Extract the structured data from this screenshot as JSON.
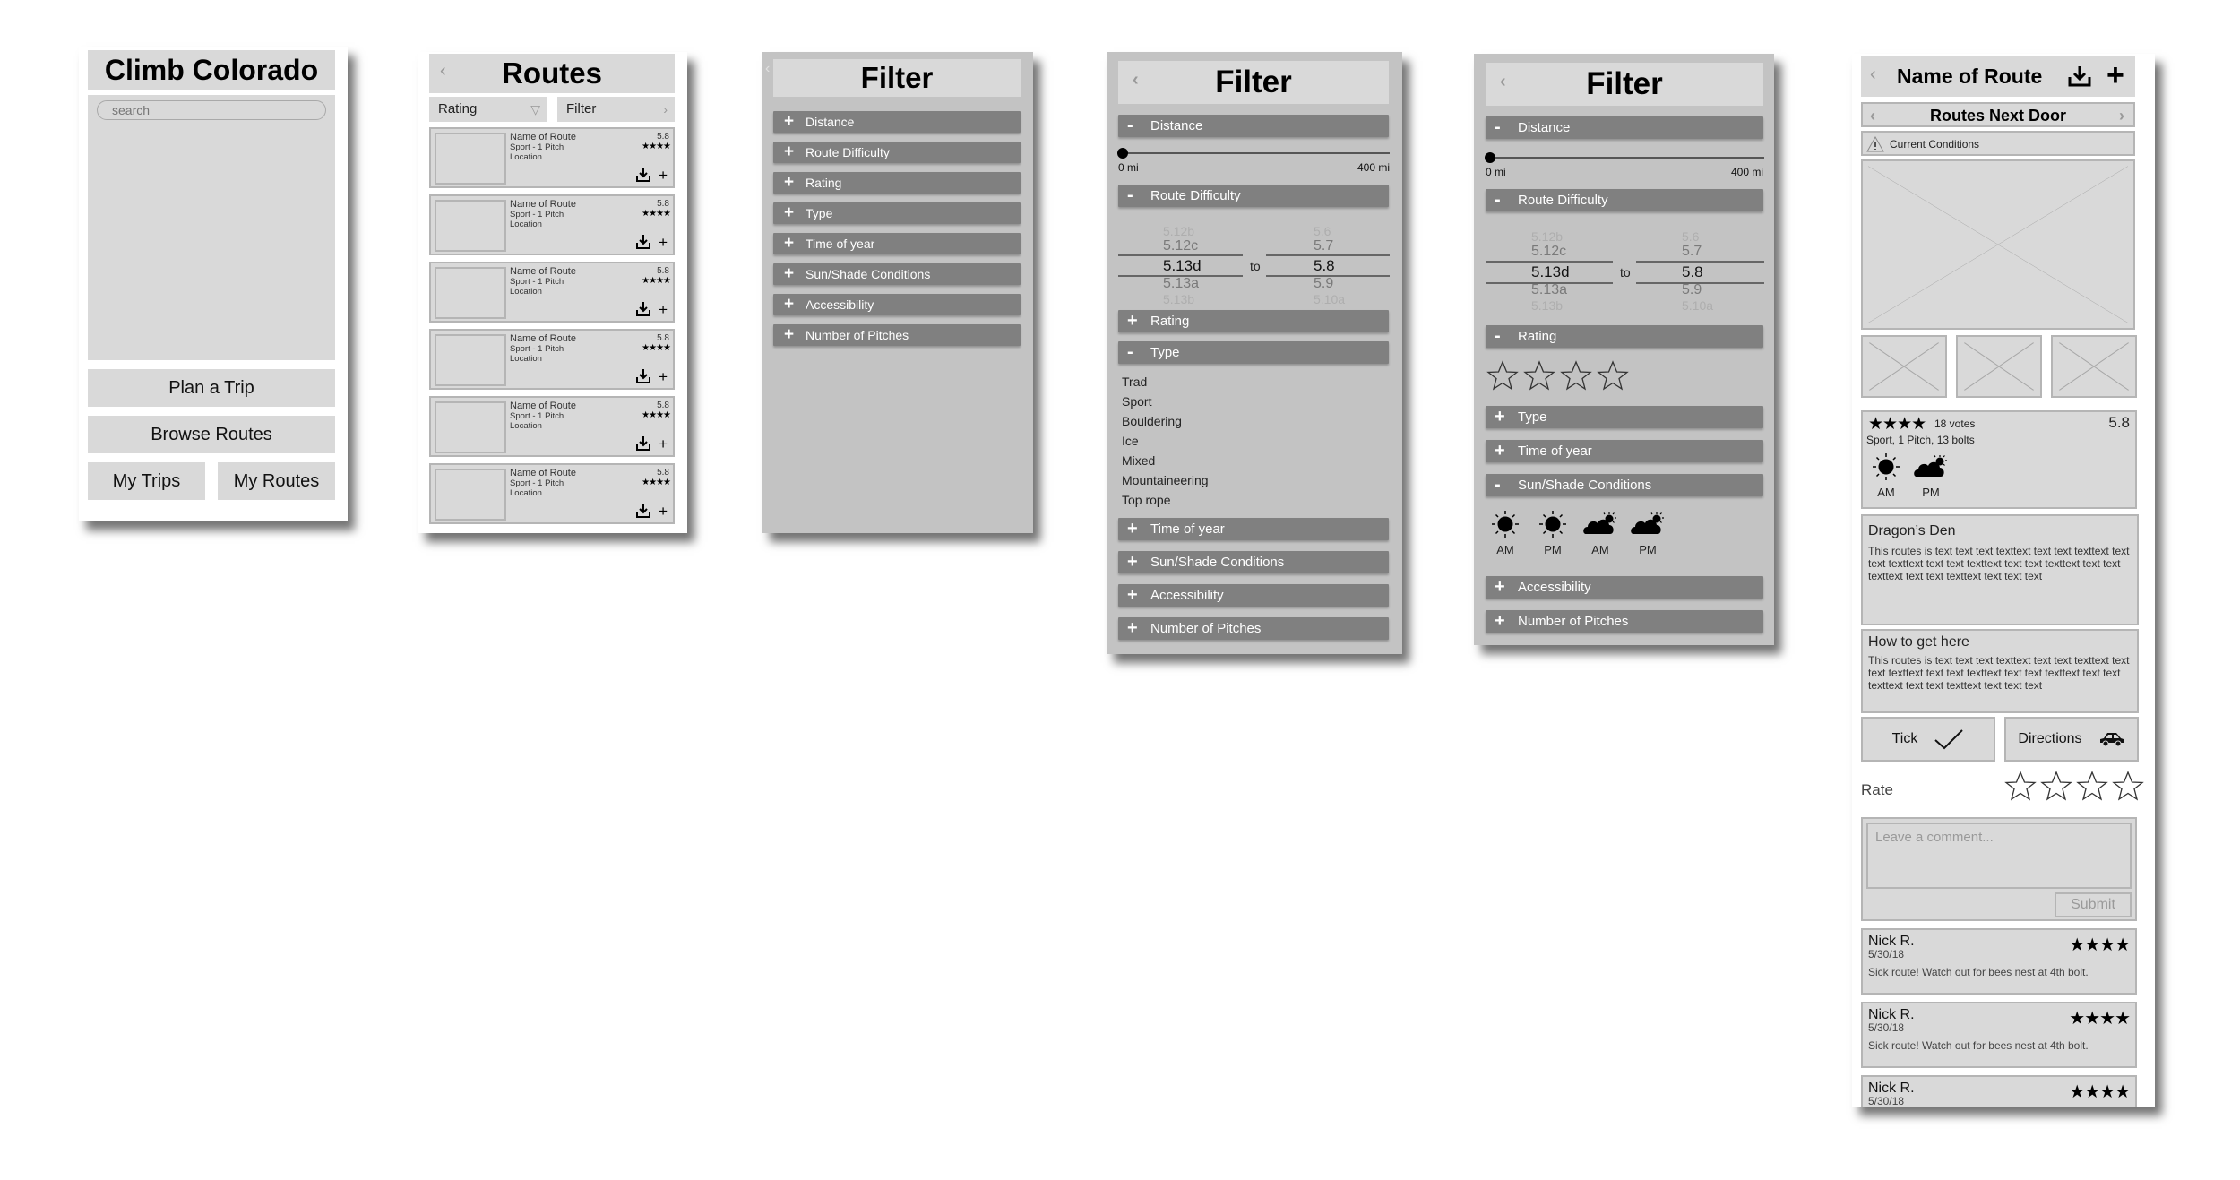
{
  "home": {
    "title": "Climb Colorado",
    "search_placeholder": "search",
    "buttons": {
      "plan_trip": "Plan a Trip",
      "browse_routes": "Browse Routes",
      "my_trips": "My Trips",
      "my_routes": "My Routes"
    }
  },
  "routes": {
    "title": "Routes",
    "back_icon": "‹",
    "sort_label": "Rating",
    "sort_icon": "▽",
    "filter_label": "Filter",
    "filter_icon": "›",
    "items": [
      {
        "name": "Name of Route",
        "subtitle": "Sport - 1 Pitch",
        "location": "Location",
        "grade": "5.8",
        "stars": "★★★★"
      },
      {
        "name": "Name of Route",
        "subtitle": "Sport - 1 Pitch",
        "location": "Location",
        "grade": "5.8",
        "stars": "★★★★"
      },
      {
        "name": "Name of Route",
        "subtitle": "Sport - 1 Pitch",
        "location": "Location",
        "grade": "5.8",
        "stars": "★★★★"
      },
      {
        "name": "Name of Route",
        "subtitle": "Sport - 1 Pitch",
        "location": "Location",
        "grade": "5.8",
        "stars": "★★★★"
      },
      {
        "name": "Name of Route",
        "subtitle": "Sport - 1 Pitch",
        "location": "Location",
        "grade": "5.8",
        "stars": "★★★★"
      },
      {
        "name": "Name of Route",
        "subtitle": "Sport - 1 Pitch",
        "location": "Location",
        "grade": "5.8",
        "stars": "★★★★"
      }
    ],
    "add_icon": "+"
  },
  "filter_collapsed": {
    "title": "Filter",
    "back_icon": "‹",
    "sections": [
      {
        "sign": "+",
        "label": "Distance"
      },
      {
        "sign": "+",
        "label": "Route Difficulty"
      },
      {
        "sign": "+",
        "label": "Rating"
      },
      {
        "sign": "+",
        "label": "Type"
      },
      {
        "sign": "+",
        "label": "Time of year"
      },
      {
        "sign": "+",
        "label": "Sun/Shade Conditions"
      },
      {
        "sign": "+",
        "label": "Accessibility"
      },
      {
        "sign": "+",
        "label": "Number of Pitches"
      }
    ]
  },
  "filter_type": {
    "title": "Filter",
    "back_icon": "‹",
    "distance": {
      "sign": "-",
      "label": "Distance",
      "min_label": "0 mi",
      "max_label": "400 mi",
      "value_fraction": 0.0
    },
    "difficulty": {
      "sign": "-",
      "label": "Route Difficulty",
      "to_label": "to",
      "from": {
        "above2": "5.12b",
        "above1": "5.12c",
        "selected": "5.13d",
        "below1": "5.13a",
        "below2": "5.13b"
      },
      "to": {
        "above2": "5.6",
        "above1": "5.7",
        "selected": "5.8",
        "below1": "5.9",
        "below2": "5.10a"
      }
    },
    "rating": {
      "sign": "+",
      "label": "Rating"
    },
    "type": {
      "sign": "-",
      "label": "Type",
      "options": [
        "Trad",
        "Sport",
        "Bouldering",
        "Ice",
        "Mixed",
        "Mountaineering",
        "Top rope"
      ]
    },
    "rest": [
      {
        "sign": "+",
        "label": "Time of year"
      },
      {
        "sign": "+",
        "label": "Sun/Shade Conditions"
      },
      {
        "sign": "+",
        "label": "Accessibility"
      },
      {
        "sign": "+",
        "label": "Number of Pitches"
      }
    ]
  },
  "filter_rating": {
    "title": "Filter",
    "back_icon": "‹",
    "distance": {
      "sign": "-",
      "label": "Distance",
      "min_label": "0 mi",
      "max_label": "400 mi",
      "value_fraction": 0.0
    },
    "difficulty": {
      "sign": "-",
      "label": "Route Difficulty",
      "to_label": "to",
      "from": {
        "above2": "5.12b",
        "above1": "5.12c",
        "selected": "5.13d",
        "below1": "5.13a",
        "below2": "5.13b"
      },
      "to": {
        "above2": "5.6",
        "above1": "5.7",
        "selected": "5.8",
        "below1": "5.9",
        "below2": "5.10a"
      }
    },
    "rating": {
      "sign": "-",
      "label": "Rating",
      "selected_stars": 0,
      "max_stars": 4
    },
    "type": {
      "sign": "+",
      "label": "Type"
    },
    "time": {
      "sign": "+",
      "label": "Time of year"
    },
    "sun": {
      "sign": "-",
      "label": "Sun/Shade Conditions",
      "options": [
        {
          "icon": "sun-icon",
          "label": "AM"
        },
        {
          "icon": "sun-icon",
          "label": "PM"
        },
        {
          "icon": "cloud-sun-icon",
          "label": "AM"
        },
        {
          "icon": "cloud-sun-icon",
          "label": "PM"
        }
      ]
    },
    "rest": [
      {
        "sign": "+",
        "label": "Accessibility"
      },
      {
        "sign": "+",
        "label": "Number of Pitches"
      }
    ]
  },
  "detail": {
    "title": "Name of Route",
    "back_icon": "‹",
    "add_icon": "+",
    "nav_title": "Routes Next Door",
    "prev_icon": "‹",
    "next_icon": "›",
    "conditions_label": "Current Conditions",
    "stars": "★★★★",
    "votes": "18 votes",
    "grade": "5.8",
    "meta": "Sport, 1 Pitch, 13 bolts",
    "sun": [
      {
        "icon": "sun-icon",
        "label": "AM"
      },
      {
        "icon": "cloud-sun-icon",
        "label": "PM"
      }
    ],
    "description": {
      "title": "Dragon’s Den",
      "text": "This routes is text text text texttext text text texttext text text texttext text text texttext text text texttext text text texttext text text texttext text text text"
    },
    "directions_info": {
      "title": "How to get here",
      "text": "This routes is text text text texttext text text texttext text text texttext text text texttext text text texttext text text texttext text text texttext text text text"
    },
    "tick_label": "Tick",
    "directions_label": "Directions",
    "rate_label": "Rate",
    "rate_value": 0,
    "rate_max": 4,
    "comment_placeholder": "Leave a comment...",
    "submit_label": "Submit",
    "comments": [
      {
        "name": "Nick R.",
        "date": "5/30/18",
        "text": "Sick route! Watch out for bees nest at 4th bolt.",
        "stars": "★★★★"
      },
      {
        "name": "Nick R.",
        "date": "5/30/18",
        "text": "Sick route! Watch out for bees nest at 4th bolt.",
        "stars": "★★★★"
      },
      {
        "name": "Nick R.",
        "date": "5/30/18",
        "text": "",
        "stars": "★★★★"
      }
    ]
  }
}
